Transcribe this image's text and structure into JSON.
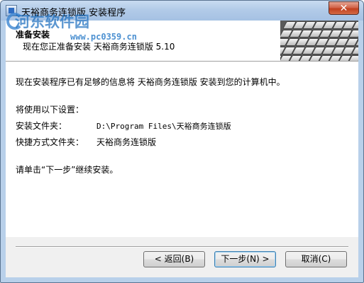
{
  "window": {
    "title": "天裕商务连锁版 安装程序",
    "close_glyph": "✕"
  },
  "watermark": {
    "text": "河东软件园",
    "url": "www.pc0359.cn"
  },
  "header": {
    "title": "准备安装",
    "subtitle": "现在您正准备安装 天裕商务连锁版 5.10"
  },
  "main": {
    "intro": "现在安装程序已有足够的信息将 天裕商务连锁版 安装到您的计算机中。",
    "settings_heading": "将使用以下设置：",
    "install_folder_label": "安装文件夹：",
    "install_folder_value": "D:\\Program Files\\天裕商务连锁版",
    "shortcut_folder_label": "快捷方式文件夹：",
    "shortcut_folder_value": "天裕商务连锁版",
    "continue_hint": "请单击“下一步”继续安装。"
  },
  "buttons": {
    "back": "< 返回(B)",
    "next": "下一步(N) >",
    "cancel": "取消(C)"
  },
  "icons": {
    "app": "installer-icon",
    "close": "close-icon",
    "header_image": "keyboard-image"
  }
}
